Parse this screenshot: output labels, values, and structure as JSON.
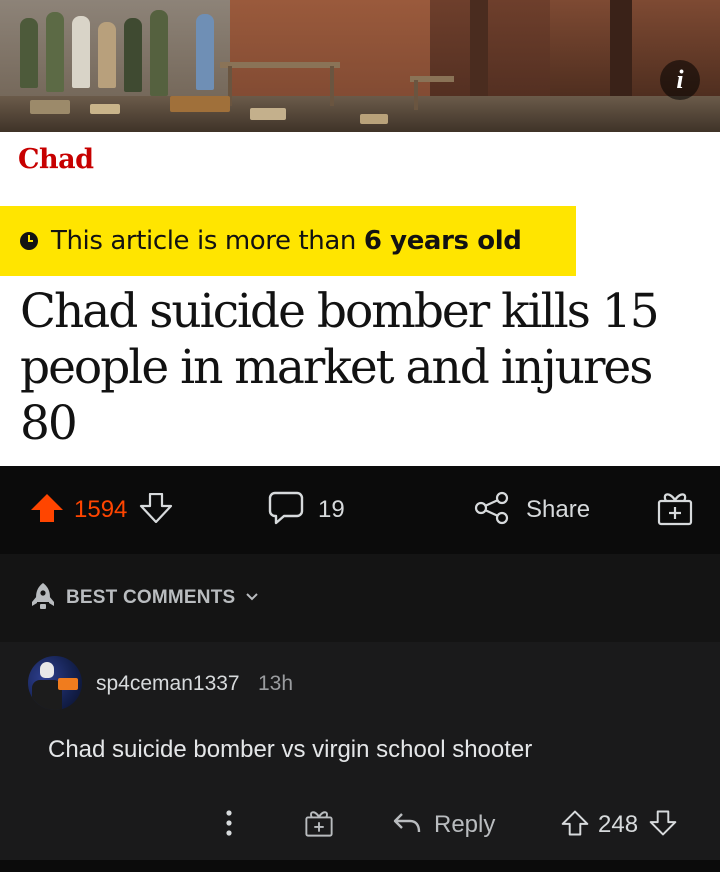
{
  "article": {
    "photo_badge": "i",
    "section": "Chad",
    "age_notice_prefix": "This article is more than ",
    "age_notice_bold": "6 years old",
    "headline": "Chad suicide bomber kills 15 people in market and injures 80"
  },
  "post_actions": {
    "score": "1594",
    "comment_count": "19",
    "share_label": "Share"
  },
  "comments_header": {
    "sort_label": "BEST COMMENTS"
  },
  "comment": {
    "username": "sp4ceman1337",
    "timestamp": "13h",
    "body": "Chad suicide bomber vs virgin school shooter",
    "reply_label": "Reply",
    "score": "248"
  },
  "colors": {
    "upvote_active": "#ff4500",
    "banner_yellow": "#ffe500",
    "section_red": "#c70000",
    "background": "#0b0b0b",
    "comment_bg": "#1a1a1b"
  },
  "icons": [
    "info-icon",
    "clock-icon",
    "upvote-icon",
    "downvote-icon",
    "comment-icon",
    "share-icon",
    "award-icon",
    "rocket-icon",
    "chevron-down-icon",
    "more-icon",
    "reply-icon"
  ]
}
